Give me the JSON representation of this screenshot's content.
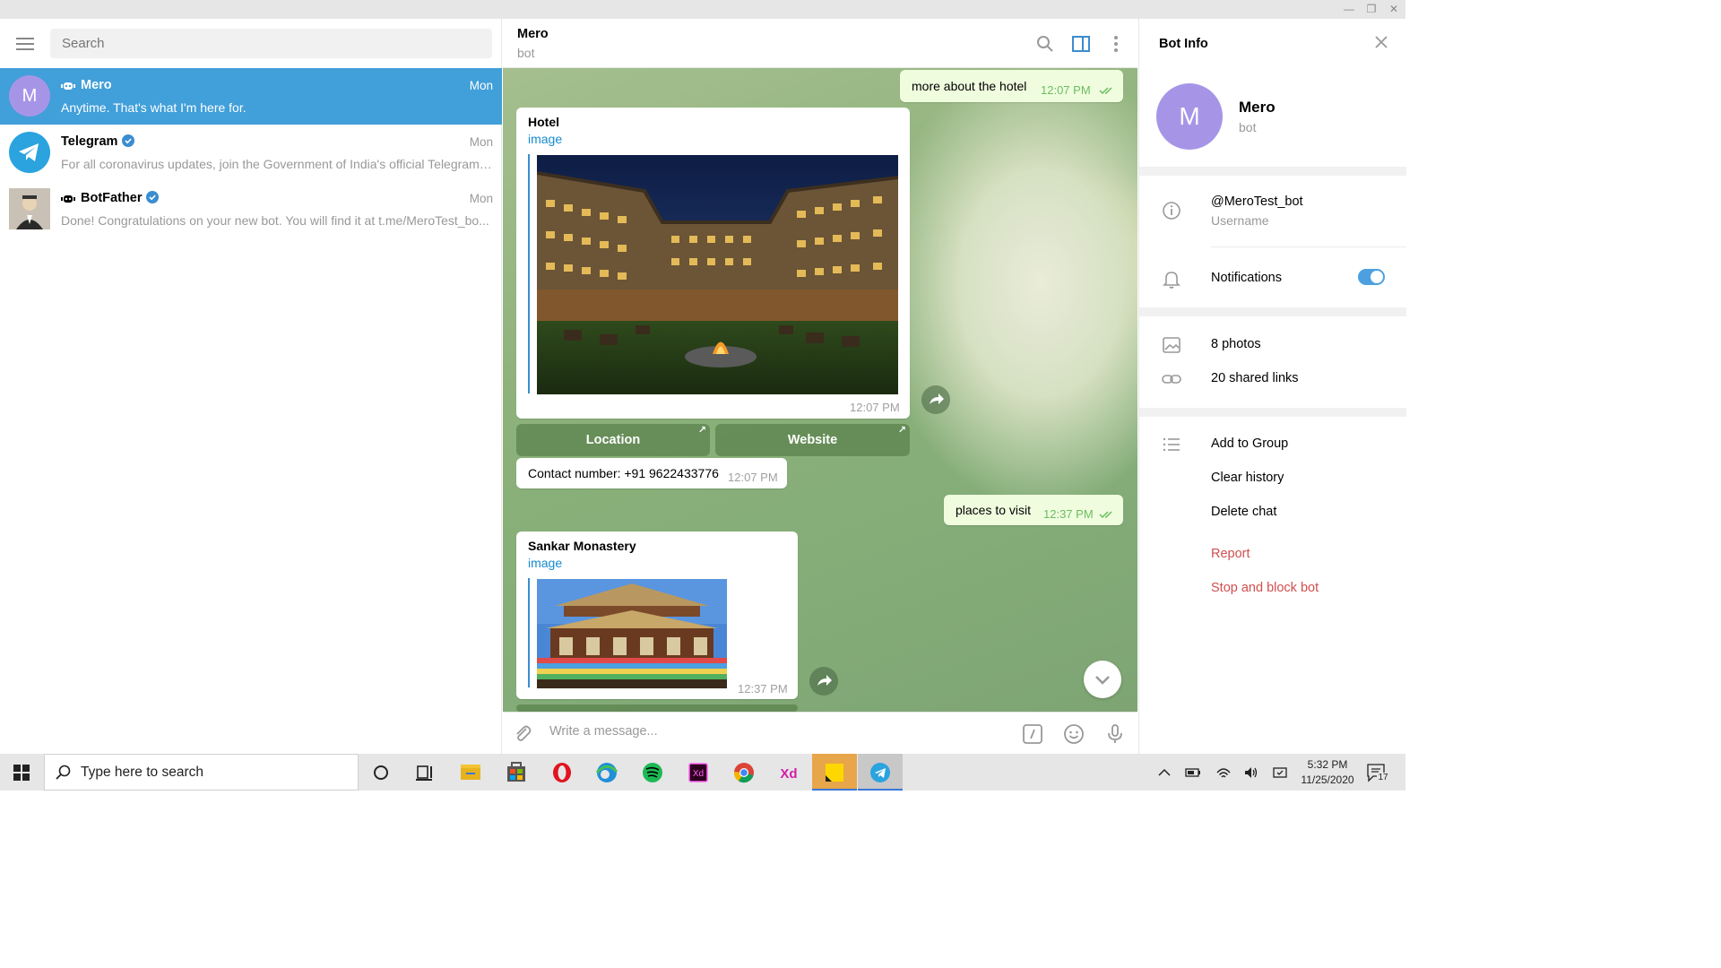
{
  "search": {
    "placeholder": "Search"
  },
  "chats": [
    {
      "name": "Mero",
      "time": "Mon",
      "preview": "Anytime. That's what I'm here for.",
      "avatar_letter": "M",
      "avatar_color": "#a695e7",
      "is_bot": true,
      "verified": false,
      "active": true
    },
    {
      "name": "Telegram",
      "time": "Mon",
      "preview": "For all coronavirus updates, join the Government of India's official Telegram ...",
      "avatar_color": "#2aa3df",
      "is_bot": false,
      "verified": true,
      "active": false
    },
    {
      "name": "BotFather",
      "time": "Mon",
      "preview": "Done! Congratulations on your new bot. You will find it at t.me/MeroTest_bo...",
      "is_bot": true,
      "verified": true,
      "active": false
    }
  ],
  "chat_header": {
    "title": "Mero",
    "subtitle": "bot"
  },
  "messages": {
    "m1": {
      "text": "more about the hotel",
      "time": "12:07 PM"
    },
    "hotel_card": {
      "title": "Hotel",
      "link": "image",
      "time": "12:07 PM"
    },
    "keyboard": {
      "location": "Location",
      "website": "Website",
      "arrow": "↗"
    },
    "contact": {
      "text": "Contact number:  +91 9622433776",
      "time": "12:07 PM"
    },
    "m2": {
      "text": "places to visit",
      "time": "12:37 PM"
    },
    "monastery_card": {
      "title": "Sankar Monastery",
      "link": "image",
      "time": "12:37 PM"
    }
  },
  "composer": {
    "placeholder": "Write a message..."
  },
  "bot_info": {
    "title": "Bot Info",
    "name": "Mero",
    "subtitle": "bot",
    "avatar_letter": "M",
    "username": "@MeroTest_bot",
    "username_label": "Username",
    "notifications_label": "Notifications",
    "notifications_on": true,
    "photos": "8 photos",
    "links": "20 shared links",
    "add_to_group": "Add to Group",
    "clear_history": "Clear history",
    "delete_chat": "Delete chat",
    "report": "Report",
    "stop_block": "Stop and block bot"
  },
  "taskbar": {
    "search_placeholder": "Type here to search",
    "time": "5:32 PM",
    "date": "11/25/2020",
    "notification_count": "17",
    "apps": [
      "cortana-icon",
      "task-view-icon",
      "file-explorer-icon",
      "store-icon",
      "opera-icon",
      "edge-icon",
      "spotify-icon",
      "adobe-xd-icon",
      "chrome-icon",
      "adobe-xd-icon",
      "sticky-notes-icon",
      "telegram-icon"
    ]
  },
  "colors": {
    "accent": "#419fd9",
    "bubble_out": "#effdde",
    "danger": "#d14e4e",
    "avatar": "#a695e7"
  }
}
